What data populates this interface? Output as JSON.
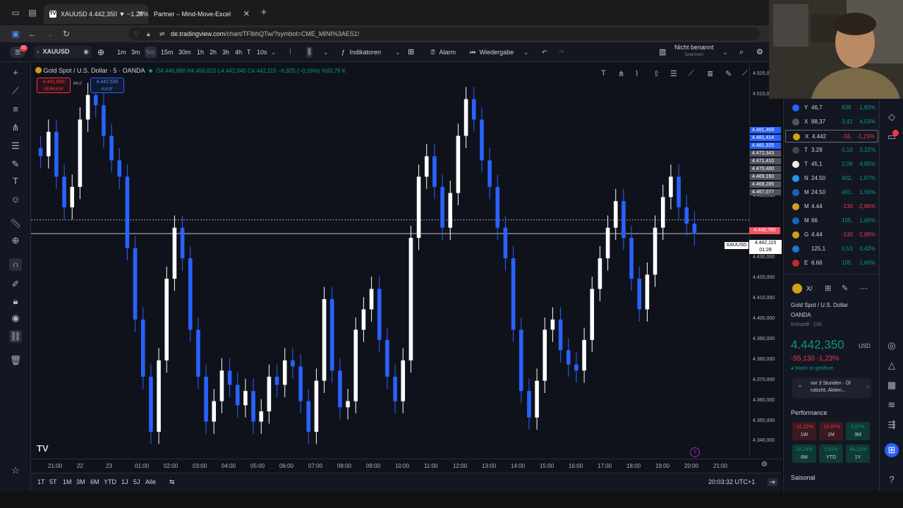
{
  "browser": {
    "tabs": [
      {
        "title": "XAUUSD 4.442,350 ▼ −1.23% I",
        "active": true
      },
      {
        "title": "Partner – Mind-Move-Excel",
        "active": false
      }
    ],
    "url_domain": "de.tradingview.com",
    "url_path": "/chart/TFlbhQTw/?symbol=CME_MINI%3AES1!"
  },
  "toolbar": {
    "symbol": "XAUUSD",
    "intervals": [
      "1m",
      "3m",
      "5m",
      "15m",
      "30m",
      "1h",
      "2h",
      "3h",
      "4h",
      "T",
      "10s"
    ],
    "selected_interval": "5m",
    "indicators_label": "Indikatoren",
    "alert_label": "Alarm",
    "replay_label": "Wiedergabe",
    "layout_name": "Nicht benannt",
    "layout_sub": "Speichern"
  },
  "legend": {
    "title": "Gold Spot / U.S. Dollar · 5 · OANDA",
    "ohlc": "O4.448,880 H4.450,615 L4.442,040 C4.442,115 −6,925 (−0,16%) Vol3,79 K"
  },
  "order_boxes": {
    "sell_price": "4.441,690",
    "sell_label": "VERKAUF",
    "spread": "84,0",
    "buy_price": "4.442,530",
    "buy_label": "KAUF"
  },
  "chart_data": {
    "type": "candlestick",
    "symbol": "XAUUSD",
    "interval": "5m",
    "x_ticks": [
      "21:00",
      "22",
      "23",
      "01:00",
      "02:00",
      "03:00",
      "04:00",
      "05:00",
      "06:00",
      "07:00",
      "08:00",
      "09:00",
      "10:00",
      "11:00",
      "12:00",
      "13:00",
      "14:00",
      "15:00",
      "16:00",
      "17:00",
      "18:00",
      "19:00",
      "20:00",
      "21:00"
    ],
    "y_ticks": [
      "4.520,000",
      "4.510,000",
      "4.460,000",
      "4.430,000",
      "4.420,000",
      "4.410,000",
      "4.400,000",
      "4.390,000",
      "4.380,000",
      "4.370,000",
      "4.360,000",
      "4.350,000",
      "4.340,000"
    ],
    "ylim": [
      4336,
      4522
    ],
    "closes": [
      4480,
      4492,
      4470,
      4455,
      4465,
      4498,
      4510,
      4505,
      4490,
      4478,
      4470,
      4435,
      4400,
      4372,
      4345,
      4380,
      4420,
      4445,
      4430,
      4395,
      4372,
      4350,
      4360,
      4375,
      4368,
      4358,
      4365,
      4350,
      4355,
      4372,
      4368,
      4380,
      4377,
      4360,
      4345,
      4370,
      4410,
      4375,
      4357,
      4360,
      4395,
      4405,
      4415,
      4390,
      4372,
      4360,
      4380,
      4440,
      4470,
      4480,
      4465,
      4445,
      4462,
      4490,
      4508,
      4498,
      4478,
      4465,
      4445,
      4430,
      4395,
      4365,
      4352,
      4370,
      4395,
      4400,
      4385,
      4378,
      4375,
      4390,
      4415,
      4430,
      4445,
      4458,
      4440,
      4420,
      4405,
      4422,
      4445,
      4460,
      4470,
      4455,
      4447,
      4442
    ],
    "current_price": "4.442,115",
    "price_line": "4.448,780",
    "countdown": "01:28",
    "right_axis_labels": [
      "4.481,469",
      "4.481,414",
      "4.481,325",
      "4.472,343",
      "4.471,410",
      "4.470,400",
      "4.469,160",
      "4.468,285",
      "4.467,077"
    ]
  },
  "timeframes": [
    "1T",
    "5T",
    "1M",
    "3M",
    "6M",
    "YTD",
    "1J",
    "5J",
    "Alle"
  ],
  "clock": "20:03:32 UTC+1",
  "watchlist": [
    {
      "sym": "Y",
      "price": "46,7",
      "chg": "838",
      "chgp": "1,83%",
      "dir": "pos",
      "color": "#2962ff"
    },
    {
      "sym": "X",
      "price": "88,37",
      "chg": "3,42",
      "chgp": "4,03%",
      "dir": "pos",
      "color": "#555"
    },
    {
      "sym": "X",
      "price": "4.442",
      "chg": "-55,",
      "chgp": "-1,23%",
      "dir": "neg",
      "color": "#d4a017"
    },
    {
      "sym": "T",
      "price": "3,29",
      "chg": "0,10",
      "chgp": "3,22%",
      "dir": "pos",
      "color": "#444"
    },
    {
      "sym": "T",
      "price": "45,1",
      "chg": "2,09",
      "chgp": "4,85%",
      "dir": "pos",
      "color": "#eee"
    },
    {
      "sym": "N",
      "price": "24.50",
      "chg": "402,",
      "chgp": "1,67%",
      "dir": "pos",
      "color": "#2196f3"
    },
    {
      "sym": "M",
      "price": "24.50",
      "chg": "401,",
      "chgp": "1,66%",
      "dir": "pos",
      "color": "#1565c0"
    },
    {
      "sym": "M",
      "price": "4.44",
      "chg": "-130",
      "chgp": "-2,86%",
      "dir": "neg",
      "color": "#d4a017"
    },
    {
      "sym": "M",
      "price": "66",
      "chg": "105,",
      "chgp": "1,60%",
      "dir": "pos",
      "color": "#1565c0"
    },
    {
      "sym": "G",
      "price": "4.44",
      "chg": "-130",
      "chgp": "-2,86%",
      "dir": "neg",
      "color": "#d4a017"
    },
    {
      "sym": "",
      "price": "125,1",
      "chg": "0,53",
      "chgp": "0,42%",
      "dir": "pos",
      "color": "#1976d2"
    },
    {
      "sym": "E",
      "price": "6.66",
      "chg": "105,",
      "chgp": "1,60%",
      "dir": "pos",
      "color": "#c62828"
    }
  ],
  "details": {
    "short": "X/",
    "name": "Gold Spot / U.S. Dollar",
    "exchange": "OANDA",
    "type": "Rohstoff · Cfd",
    "price": "4.442,350",
    "currency": "USD",
    "change": "-55,130 -1,23%",
    "status": "Markt ist geöffnet",
    "news": "vor 3 Stunden · Öl rutscht, Aktien...",
    "performance_title": "Performance",
    "performance": [
      {
        "v": "-11,22%",
        "l": "1W",
        "dir": "neg"
      },
      {
        "v": "-10,97%",
        "l": "1M",
        "dir": "neg"
      },
      {
        "v": "0,07%",
        "l": "3M",
        "dir": "pos"
      },
      {
        "v": "18,24%",
        "l": "6M",
        "dir": "pos"
      },
      {
        "v": "2,91%",
        "l": "YTD",
        "dir": "pos"
      },
      {
        "v": "46,21%",
        "l": "1Y",
        "dir": "pos"
      }
    ],
    "seasonal_title": "Saisonal"
  }
}
